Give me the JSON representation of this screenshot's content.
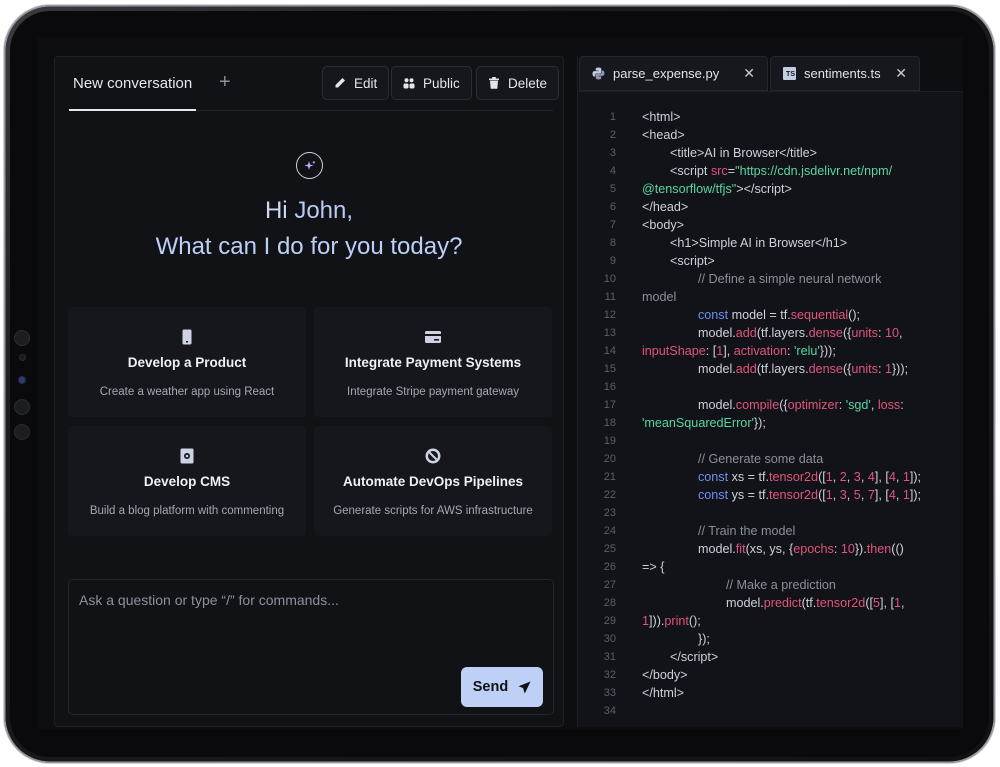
{
  "chat": {
    "tab_label": "New conversation",
    "tab_add": "+",
    "buttons": {
      "edit": "Edit",
      "public": "Public",
      "delete": "Delete"
    },
    "greeting_hi": "Hi ",
    "greeting_name": "John,",
    "greeting_question": "What can I do for you today?",
    "cards": [
      {
        "icon": "phone-icon",
        "title": "Develop a Product",
        "subtitle": "Create a weather app using React"
      },
      {
        "icon": "payment-card-icon",
        "title": "Integrate Payment Systems",
        "subtitle": "Integrate Stripe payment gateway"
      },
      {
        "icon": "document-gear-icon",
        "title": "Develop CMS",
        "subtitle": "Build a blog platform with commenting"
      },
      {
        "icon": "devops-cycle-icon",
        "title": "Automate DevOps Pipelines",
        "subtitle": "Generate scripts for AWS infrastructure"
      }
    ],
    "input_placeholder": "Ask a question or type “/” for commands...",
    "send_label": "Send"
  },
  "editor": {
    "tabs": [
      {
        "icon": "python-icon",
        "name": "parse_expense.py",
        "close": "✕"
      },
      {
        "icon": "typescript-icon",
        "badge": "TS",
        "name": "sentiments.ts",
        "close": "✕"
      }
    ],
    "code_lines": [
      {
        "n": "1",
        "html": "&lt;html&gt;"
      },
      {
        "n": "2",
        "html": "&lt;head&gt;"
      },
      {
        "n": "3",
        "html": "        &lt;title&gt;AI in Browser&lt;/title&gt;"
      },
      {
        "n": "4",
        "html": "        &lt;script <span class=\"fn\">src</span>=<span class=\"str\">\"https://cdn.jsdelivr.net/npm/</span>"
      },
      {
        "n": "5",
        "html": "<span class=\"str\">@tensorflow/tfjs\"</span>&gt;&lt;/script&gt;"
      },
      {
        "n": "6",
        "html": "&lt;/head&gt;"
      },
      {
        "n": "7",
        "html": "&lt;body&gt;"
      },
      {
        "n": "8",
        "html": "        &lt;h1&gt;Simple AI in Browser&lt;/h1&gt;"
      },
      {
        "n": "9",
        "html": "        &lt;script&gt;"
      },
      {
        "n": "10",
        "html": "                <span class=\"cm\">// Define a simple neural network</span>"
      },
      {
        "n": "11",
        "html": "<span class=\"cm\">model</span>"
      },
      {
        "n": "12",
        "html": "                <span class=\"kw\">const</span> model = tf.<span class=\"fn\">sequential</span>();"
      },
      {
        "n": "13",
        "html": "                model.<span class=\"fn\">add</span>(tf.layers.<span class=\"fn\">dense</span>({<span class=\"fn\">units</span>: <span class=\"num\">10</span>,"
      },
      {
        "n": "14",
        "html": "<span class=\"fn\">inputShape</span>: [<span class=\"num\">1</span>], <span class=\"fn\">activation</span>: <span class=\"str\">'relu'</span>}));"
      },
      {
        "n": "15",
        "html": "                model.<span class=\"fn\">add</span>(tf.layers.<span class=\"fn\">dense</span>({<span class=\"fn\">units</span>: <span class=\"num\">1</span>}));"
      },
      {
        "n": "16",
        "html": ""
      },
      {
        "n": "17",
        "html": "                model.<span class=\"fn\">compile</span>({<span class=\"fn\">optimizer</span>: <span class=\"str\">'sgd'</span>, <span class=\"fn\">loss</span>:"
      },
      {
        "n": "18",
        "html": "<span class=\"str\">'meanSquaredError'</span>});"
      },
      {
        "n": "19",
        "html": ""
      },
      {
        "n": "20",
        "html": "                <span class=\"cm\">// Generate some data</span>"
      },
      {
        "n": "21",
        "html": "                <span class=\"kw\">const</span> xs = tf.<span class=\"fn\">tensor2d</span>([<span class=\"num\">1</span>, <span class=\"num\">2</span>, <span class=\"num\">3</span>, <span class=\"num\">4</span>], [<span class=\"num\">4</span>, <span class=\"num\">1</span>]);"
      },
      {
        "n": "22",
        "html": "                <span class=\"kw\">const</span> ys = tf.<span class=\"fn\">tensor2d</span>([<span class=\"num\">1</span>, <span class=\"num\">3</span>, <span class=\"num\">5</span>, <span class=\"num\">7</span>], [<span class=\"num\">4</span>, <span class=\"num\">1</span>]);"
      },
      {
        "n": "23",
        "html": ""
      },
      {
        "n": "24",
        "html": "                <span class=\"cm\">// Train the model</span>"
      },
      {
        "n": "25",
        "html": "                model.<span class=\"fn\">fit</span>(xs, ys, {<span class=\"fn\">epochs</span>: <span class=\"num\">10</span>}).<span class=\"fn\">then</span>(()"
      },
      {
        "n": "26",
        "html": "=&gt; {"
      },
      {
        "n": "27",
        "html": "                        <span class=\"cm\">// Make a prediction</span>"
      },
      {
        "n": "28",
        "html": "                        model.<span class=\"fn\">predict</span>(tf.<span class=\"fn\">tensor2d</span>([<span class=\"num\">5</span>], [<span class=\"num\">1</span>,"
      },
      {
        "n": "29",
        "html": "<span class=\"num\">1</span>])).<span class=\"fn\">print</span>();"
      },
      {
        "n": "30",
        "html": "                });"
      },
      {
        "n": "31",
        "html": "        &lt;/script&gt;"
      },
      {
        "n": "32",
        "html": "&lt;/body&gt;"
      },
      {
        "n": "33",
        "html": "&lt;/html&gt;"
      },
      {
        "n": "34",
        "html": ""
      }
    ]
  },
  "colors": {
    "accent": "#bfd0f6",
    "keyword": "#6e8ff5",
    "function": "#e0557e",
    "string": "#5ad6a2",
    "comment": "#8b8f99"
  }
}
